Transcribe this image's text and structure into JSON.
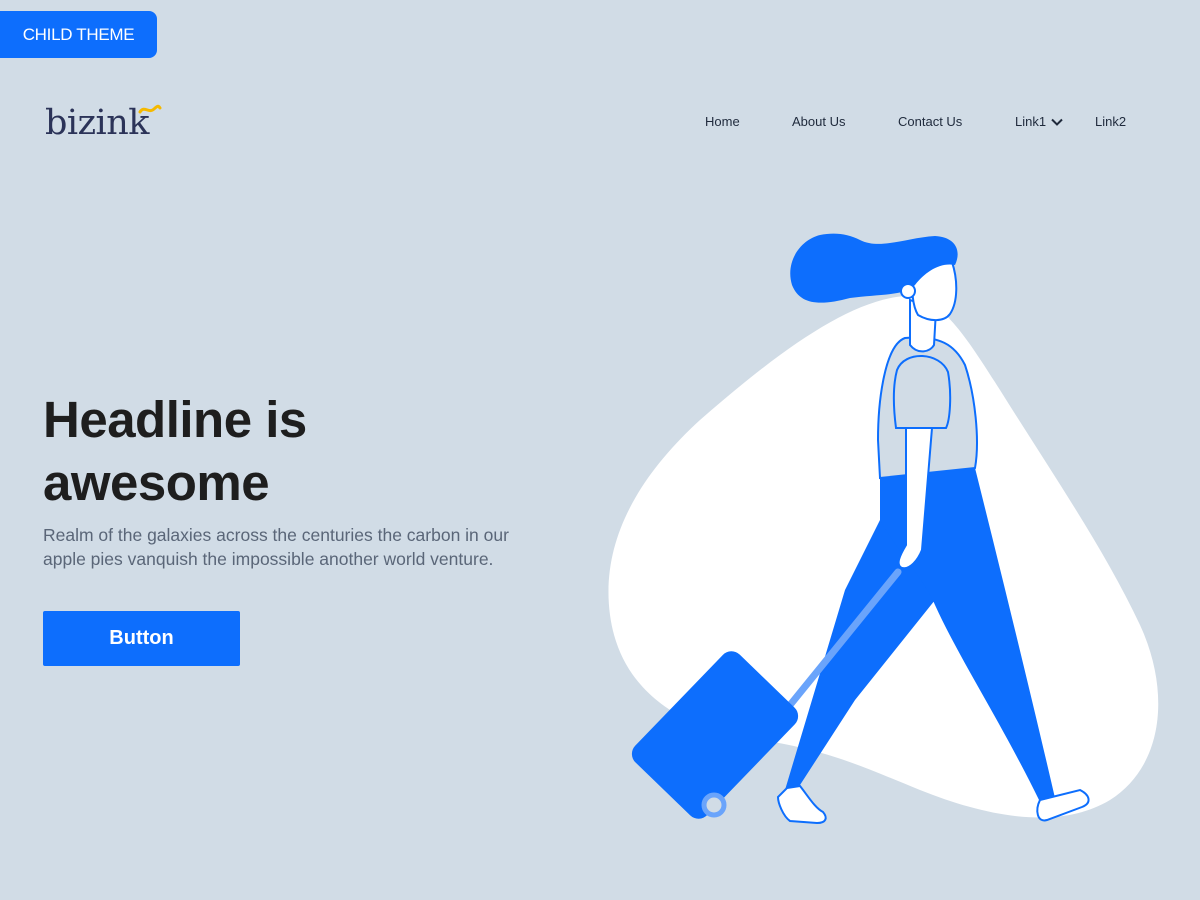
{
  "badge": {
    "label": "CHILD THEME"
  },
  "brand": {
    "logo_text": "bizink"
  },
  "nav": {
    "items": [
      {
        "label": "Home"
      },
      {
        "label": "About Us"
      },
      {
        "label": "Contact Us"
      },
      {
        "label": "Link1",
        "icon": "chevron-down-icon"
      },
      {
        "label": "Link2"
      }
    ]
  },
  "hero": {
    "headline_line1": "Headline is",
    "headline_line2": "awesome",
    "body": "Realm of the galaxies across the centuries the carbon in our apple pies vanquish the impossible another world venture.",
    "button_label": "Button"
  },
  "colors": {
    "background": "#d1dce6",
    "accent": "#0d6efd",
    "heading": "#1e1e1e",
    "body_text": "#5a6678",
    "logo": "#2b3358",
    "logo_swoosh": "#f5b900"
  }
}
